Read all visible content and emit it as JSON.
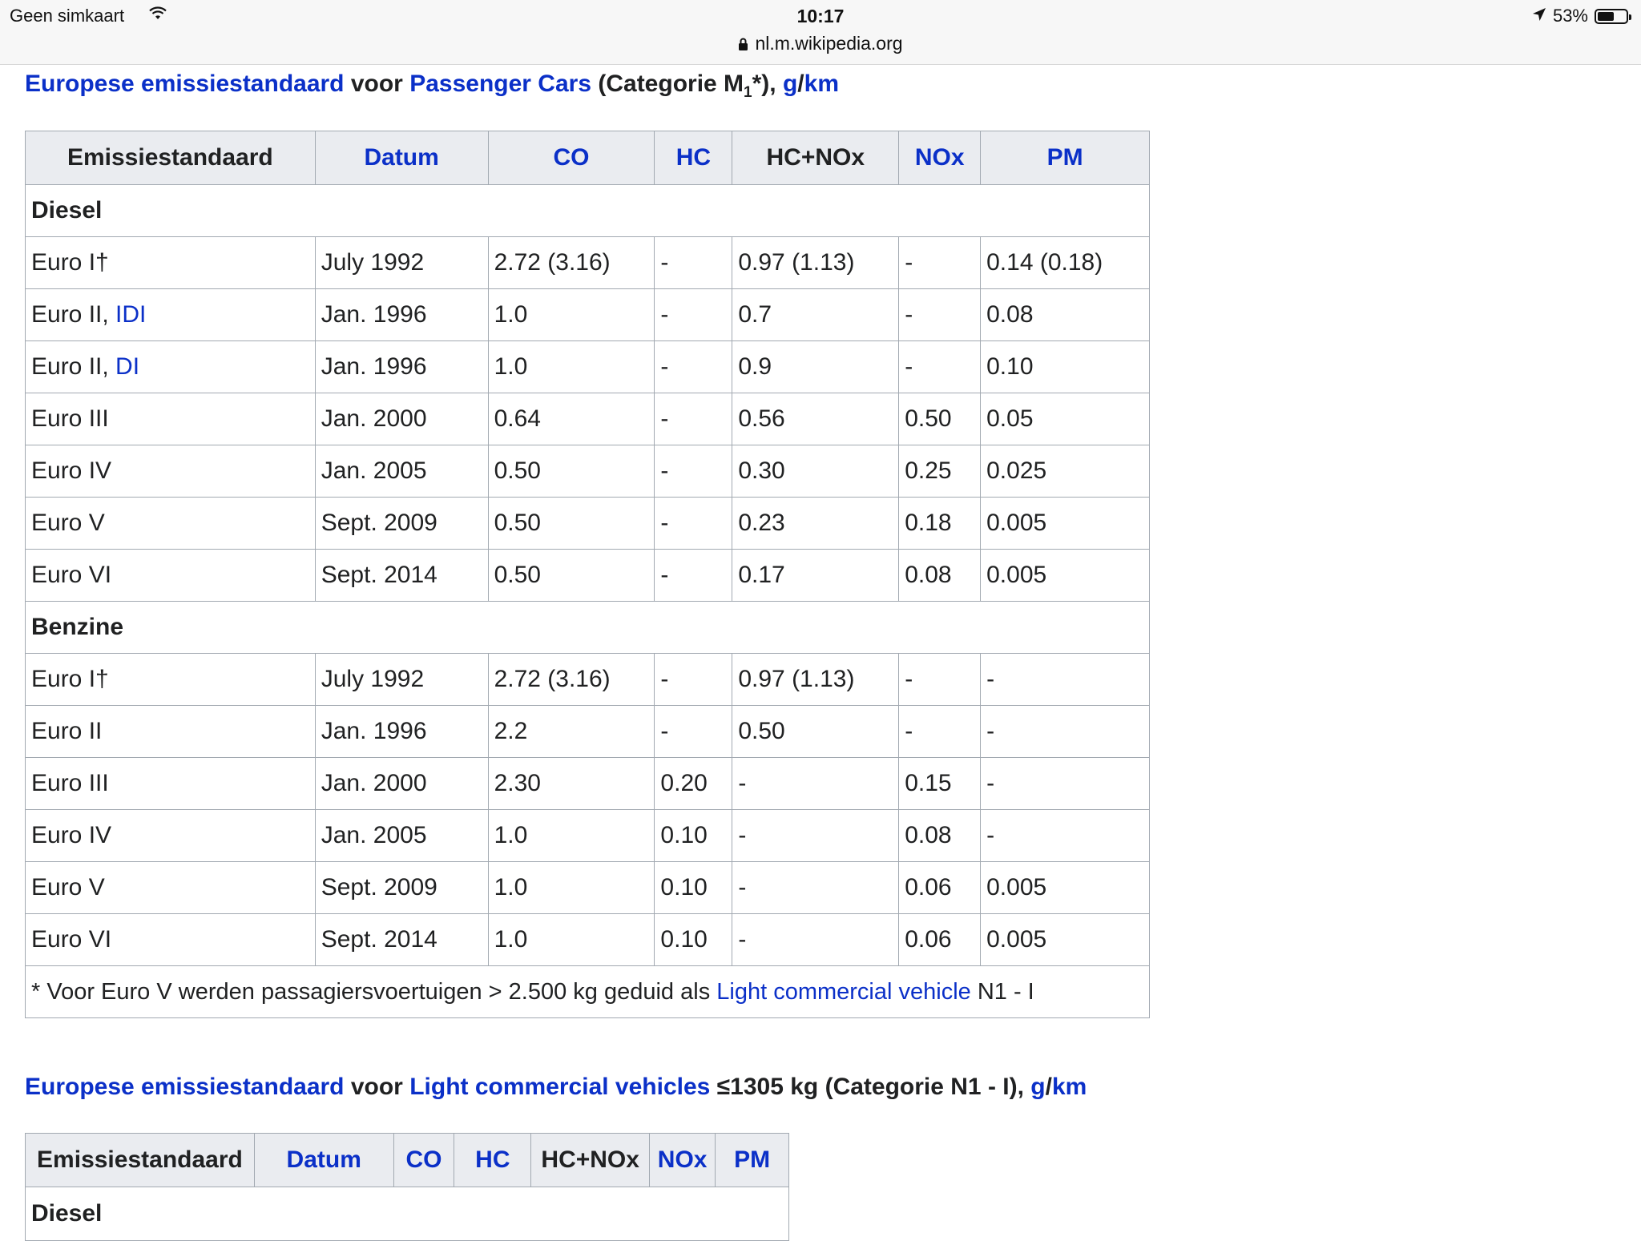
{
  "status_bar": {
    "carrier": "Geen simkaart",
    "time": "10:17",
    "url": "nl.m.wikipedia.org",
    "battery": "53%",
    "battery_level": 0.53
  },
  "table1": {
    "caption": {
      "link1": "Europese emissiestandaard",
      "text1": " voor ",
      "link2": "Passenger Cars",
      "text2": " (Categorie M",
      "sub": "1",
      "text3": "*), ",
      "link3": "g",
      "slash": "/",
      "link4": "km"
    },
    "headers": [
      "Emissiestandaard",
      "Datum",
      "CO",
      "HC",
      "HC+NOx",
      "NOx",
      "PM"
    ],
    "diesel_label": "Diesel",
    "diesel_rows": [
      [
        "Euro I†",
        "July 1992",
        "2.72 (3.16)",
        "-",
        "0.97 (1.13)",
        "-",
        "0.14 (0.18)"
      ],
      [
        "Euro II, ",
        "Jan. 1996",
        "1.0",
        "-",
        "0.7",
        "-",
        "0.08"
      ],
      [
        "Euro II, ",
        "Jan. 1996",
        "1.0",
        "-",
        "0.9",
        "-",
        "0.10"
      ],
      [
        "Euro III",
        "Jan. 2000",
        "0.64",
        "-",
        "0.56",
        "0.50",
        "0.05"
      ],
      [
        "Euro IV",
        "Jan. 2005",
        "0.50",
        "-",
        "0.30",
        "0.25",
        "0.025"
      ],
      [
        "Euro V",
        "Sept. 2009",
        "0.50",
        "-",
        "0.23",
        "0.18",
        "0.005"
      ],
      [
        "Euro VI",
        "Sept. 2014",
        "0.50",
        "-",
        "0.17",
        "0.08",
        "0.005"
      ]
    ],
    "diesel_links": [
      "",
      "IDI",
      "DI",
      "",
      "",
      "",
      ""
    ],
    "benzine_label": "Benzine",
    "benzine_rows": [
      [
        "Euro I†",
        "July 1992",
        "2.72 (3.16)",
        "-",
        "0.97 (1.13)",
        "-",
        "-"
      ],
      [
        "Euro II",
        "Jan. 1996",
        "2.2",
        "-",
        "0.50",
        "-",
        "-"
      ],
      [
        "Euro III",
        "Jan. 2000",
        "2.30",
        "0.20",
        "-",
        "0.15",
        "-"
      ],
      [
        "Euro IV",
        "Jan. 2005",
        "1.0",
        "0.10",
        "-",
        "0.08",
        "-"
      ],
      [
        "Euro V",
        "Sept. 2009",
        "1.0",
        "0.10",
        "-",
        "0.06",
        "0.005"
      ],
      [
        "Euro VI",
        "Sept. 2014",
        "1.0",
        "0.10",
        "-",
        "0.06",
        "0.005"
      ]
    ],
    "note": {
      "text": "* Voor Euro V werden passagiersvoertuigen > 2.500 kg geduid als ",
      "link": "Light commercial vehicle",
      "tail": " N1 - I"
    }
  },
  "table2": {
    "caption": {
      "link1": "Europese emissiestandaard",
      "text1": " voor ",
      "link2": "Light commercial vehicles",
      "text2": " ≤1305 kg (Categorie N1 - I), ",
      "link3": "g",
      "slash": "/",
      "link4": "km"
    },
    "headers": [
      "Emissiestandaard",
      "Datum",
      "CO",
      "HC",
      "HC+NOx",
      "NOx",
      "PM"
    ],
    "diesel_label": "Diesel"
  }
}
